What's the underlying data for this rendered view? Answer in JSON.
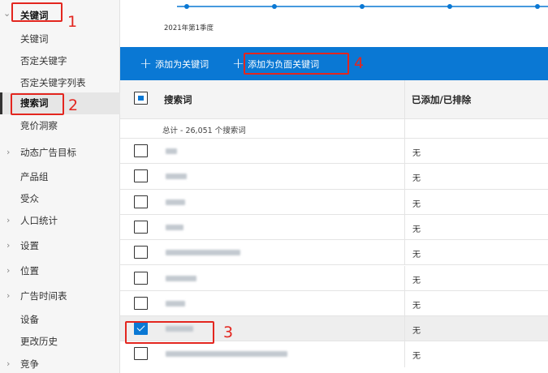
{
  "sidebar": {
    "items": [
      {
        "label": "关键词",
        "chevron": "⌄"
      },
      {
        "label": "关键词"
      },
      {
        "label": "否定关键字"
      },
      {
        "label": "否定关键字列表"
      },
      {
        "label": "搜索词"
      },
      {
        "label": "竞价洞察"
      },
      {
        "label": "动态广告目标",
        "chevron": "›"
      },
      {
        "label": "产品组"
      },
      {
        "label": "受众"
      },
      {
        "label": "人口统计",
        "chevron": "›"
      },
      {
        "label": "设置",
        "chevron": "›"
      },
      {
        "label": "位置",
        "chevron": "›"
      },
      {
        "label": "广告时间表",
        "chevron": "›"
      },
      {
        "label": "设备"
      },
      {
        "label": "更改历史"
      },
      {
        "label": "竞争",
        "chevron": "›"
      }
    ]
  },
  "chart": {
    "quarter_label": "2021年第1季度"
  },
  "toolbar": {
    "add_keyword_label": "添加为关键词",
    "add_negative_label": "添加为负面关键词",
    "plus": "+"
  },
  "table": {
    "col_search_term": "搜索词",
    "col_added_excluded": "已添加/已排除",
    "total_label": "总计 - 26,051 个搜索词",
    "rows": [
      {
        "status": "无",
        "checked": false
      },
      {
        "status": "无",
        "checked": false
      },
      {
        "status": "无",
        "checked": false
      },
      {
        "status": "无",
        "checked": false
      },
      {
        "status": "无",
        "checked": false
      },
      {
        "status": "无",
        "checked": false
      },
      {
        "status": "无",
        "checked": false
      },
      {
        "status": "无",
        "checked": true
      },
      {
        "status": "无",
        "checked": false
      }
    ]
  },
  "annotations": {
    "n1": "1",
    "n2": "2",
    "n3": "3",
    "n4": "4"
  },
  "colors": {
    "accent": "#0a78d4",
    "highlight": "#e3261f"
  }
}
